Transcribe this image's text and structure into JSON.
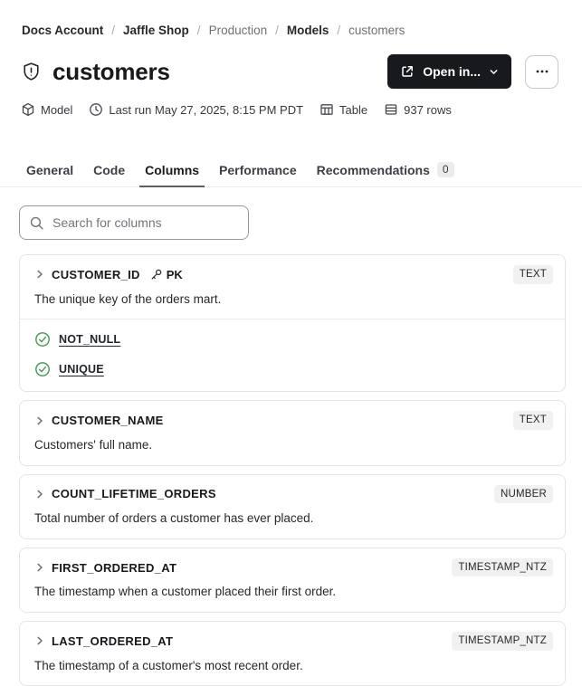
{
  "breadcrumb": {
    "separator": "/",
    "items": [
      {
        "label": "Docs Account",
        "emphasis": true
      },
      {
        "label": "Jaffle Shop",
        "emphasis": true
      },
      {
        "label": "Production",
        "emphasis": false
      },
      {
        "label": "Models",
        "emphasis": true
      },
      {
        "label": "customers",
        "emphasis": false
      }
    ]
  },
  "header": {
    "title": "customers",
    "title_icon": "shield-alert-icon",
    "open_in_button": {
      "label": "Open in...",
      "left_icon": "external-link-icon",
      "right_icon": "chevron-down-icon"
    },
    "more_button": {
      "icon": "ellipsis-icon"
    }
  },
  "meta": {
    "items": [
      {
        "icon": "cube-icon",
        "label": "Model"
      },
      {
        "icon": "clock-icon",
        "label": "Last run May 27, 2025, 8:15 PM PDT"
      },
      {
        "icon": "table-icon",
        "label": "Table"
      },
      {
        "icon": "database-rows-icon",
        "label": "937 rows"
      }
    ]
  },
  "tabs": {
    "items": [
      {
        "label": "General",
        "active": false
      },
      {
        "label": "Code",
        "active": false
      },
      {
        "label": "Columns",
        "active": true
      },
      {
        "label": "Performance",
        "active": false
      },
      {
        "label": "Recommendations",
        "active": false,
        "badge": "0"
      }
    ]
  },
  "search": {
    "placeholder": "Search for columns",
    "value": "",
    "icon": "search-icon"
  },
  "columns": [
    {
      "name": "CUSTOMER_ID",
      "pk_icon": "key-icon",
      "pk_label": "PK",
      "type": "TEXT",
      "description": "The unique key of the orders mart.",
      "tests": [
        "NOT_NULL",
        "UNIQUE"
      ],
      "test_icon": "check-circle-icon"
    },
    {
      "name": "CUSTOMER_NAME",
      "type": "TEXT",
      "description": "Customers' full name."
    },
    {
      "name": "COUNT_LIFETIME_ORDERS",
      "type": "NUMBER",
      "description": "Total number of orders a customer has ever placed."
    },
    {
      "name": "FIRST_ORDERED_AT",
      "type": "TIMESTAMP_NTZ",
      "description": "The timestamp when a customer placed their first order."
    },
    {
      "name": "LAST_ORDERED_AT",
      "type": "TIMESTAMP_NTZ",
      "description": "The timestamp of a customer's most recent order."
    }
  ],
  "colors": {
    "accent_dark_button": "#17191c",
    "test_pass_green": "#3d9a50",
    "type_badge_bg": "#f1f1f2",
    "card_border": "#e3e4e6",
    "active_tab_underline": "#5b5e64"
  }
}
